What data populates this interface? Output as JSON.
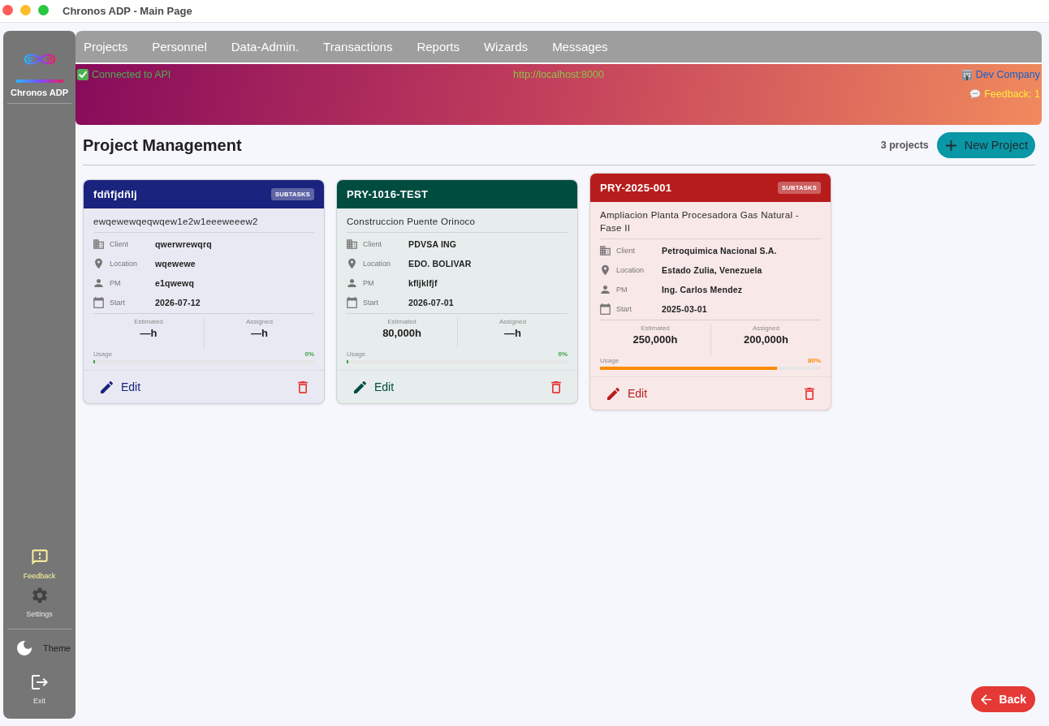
{
  "window": {
    "title": "Chronos ADP - Main Page"
  },
  "sidebar": {
    "app_name": "Chronos ADP",
    "actions": [
      {
        "kind": "stacked",
        "label": "Feedback",
        "selected": true
      },
      {
        "kind": "stacked",
        "label": "Settings",
        "selected": false
      }
    ],
    "footer": [
      {
        "kind": "inline",
        "label": "Theme"
      },
      {
        "kind": "stacked",
        "label": "Exit"
      }
    ]
  },
  "menu": [
    "Projects",
    "Personnel",
    "Data-Admin.",
    "Transactions",
    "Reports",
    "Wizards",
    "Messages"
  ],
  "status": {
    "connected": true,
    "connection": "Connected to API",
    "api_url": "http://localhost:8000",
    "company": "Dev Company",
    "feedback": "Feedback: 1"
  },
  "page": {
    "title": "Project Management",
    "count": "3 projects",
    "new_button": "New Project"
  },
  "projects": [
    {
      "code": "fdñfjdñlj",
      "badge": "SUBTASKS",
      "color": "#1a237e",
      "description": "ewqewewqeqwqew1e2w1eeeweeew2",
      "details": [
        {
          "label": "Client",
          "value": "qwerwrewqrq"
        },
        {
          "label": "Location",
          "value": "wqewewe"
        },
        {
          "label": "PM",
          "value": "e1qwewq"
        },
        {
          "label": "Start",
          "value": "2026-07-12"
        }
      ],
      "stats": [
        {
          "label": "Estimated",
          "value": "—h"
        },
        {
          "label": "Assigned",
          "value": "—h"
        }
      ],
      "usage": {
        "label": "Usage",
        "reading": "0%",
        "level": 0
      },
      "edit_label": "Edit"
    },
    {
      "code": "PRY-1016-TEST",
      "color": "#004d40",
      "description": "Construccion Puente Orinoco",
      "details": [
        {
          "label": "Client",
          "value": "PDVSA ING"
        },
        {
          "label": "Location",
          "value": "EDO. BOLIVAR"
        },
        {
          "label": "PM",
          "value": "kfljklfjf"
        },
        {
          "label": "Start",
          "value": "2026-07-01"
        }
      ],
      "stats": [
        {
          "label": "Estimated",
          "value": "80,000h"
        },
        {
          "label": "Assigned",
          "value": "—h"
        }
      ],
      "usage": {
        "label": "Usage",
        "reading": "0%",
        "level": 0
      },
      "edit_label": "Edit"
    },
    {
      "code": "PRY-2025-001",
      "badge": "SUBTASKS",
      "color": "#b71c1c",
      "description": "Ampliacion Planta Procesadora Gas Natural - Fase II",
      "details": [
        {
          "label": "Client",
          "value": "Petroquimica Nacional S.A."
        },
        {
          "label": "Location",
          "value": "Estado Zulia, Venezuela"
        },
        {
          "label": "PM",
          "value": "Ing. Carlos Mendez"
        },
        {
          "label": "Start",
          "value": "2025-03-01"
        }
      ],
      "stats": [
        {
          "label": "Estimated",
          "value": "250,000h"
        },
        {
          "label": "Assigned",
          "value": "200,000h"
        }
      ],
      "usage": {
        "label": "Usage",
        "reading": "80%",
        "level": 0.8
      },
      "edit_label": "Edit"
    }
  ],
  "back_button": "Back"
}
